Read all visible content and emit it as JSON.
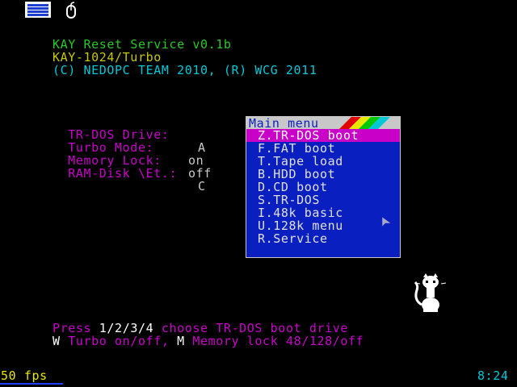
{
  "tray": {
    "icons": [
      "menu-icon",
      "mouse-icon"
    ]
  },
  "header": {
    "line1": "KAY Reset Service v0.1b",
    "line2": "KAY-1024/Turbo",
    "line3": "(C) NEDOPC TEAM 2010, (R) WCG 2011"
  },
  "settings": [
    {
      "label": "TR-DOS Drive:",
      "value": "A"
    },
    {
      "label": "Turbo Mode:",
      "value": "on"
    },
    {
      "label": "Memory Lock:",
      "value": "off"
    },
    {
      "label": "RAM-Disk \\Et.:",
      "value": "C"
    }
  ],
  "main_menu": {
    "title": "Main menu",
    "stripe_colors": [
      "#e00000",
      "#e8e800",
      "#00c800",
      "#00c8d8"
    ],
    "items": [
      {
        "label": "Z.TR-DOS boot",
        "selected": true
      },
      {
        "label": "F.FAT boot",
        "selected": false
      },
      {
        "label": "T.Tape load",
        "selected": false
      },
      {
        "label": "B.HDD boot",
        "selected": false
      },
      {
        "label": "D.CD boot",
        "selected": false
      },
      {
        "label": "S.TR-DOS",
        "selected": false
      },
      {
        "label": "I.48k basic",
        "selected": false
      },
      {
        "label": "U.128k menu",
        "selected": false
      },
      {
        "label": "R.Service",
        "selected": false
      }
    ]
  },
  "instructions": {
    "line1_prefix": "Press ",
    "line1_keys": "1/2/3/4",
    "line1_suffix": " choose TR-DOS boot drive",
    "line2_key1": "W",
    "line2_mid": " Turbo on/off, ",
    "line2_key2": "M",
    "line2_suffix": " Memory lock 48/128/off"
  },
  "status": {
    "fps": "50 fps",
    "clock": "8:24"
  },
  "colors": {
    "background": "#000000",
    "menu_bg": "#0a1fc0",
    "selection": "#c800c8"
  }
}
